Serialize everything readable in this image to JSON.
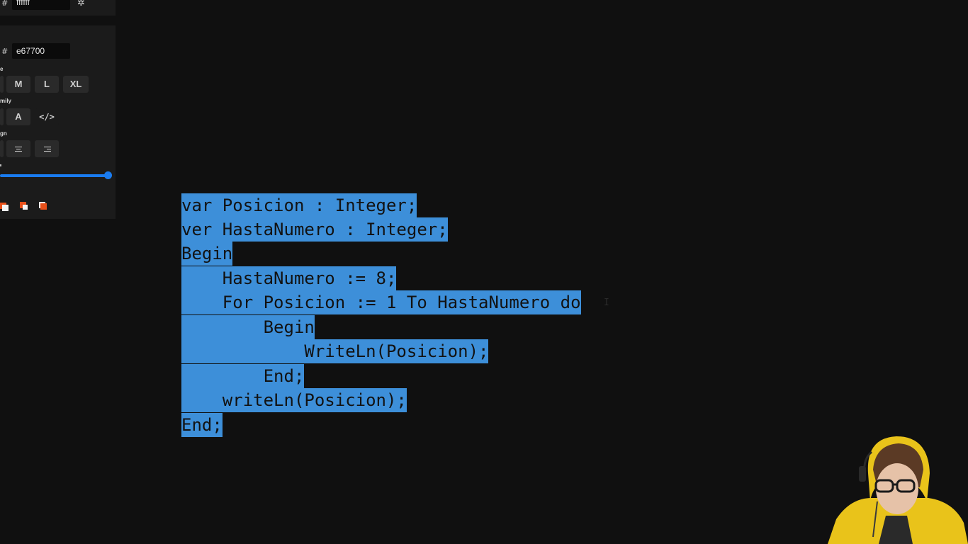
{
  "style_panel": {
    "stroke_hash": "#",
    "stroke_hex": "ffffff",
    "fill_hash": "#",
    "fill_hex": "e67700",
    "size_label": "e",
    "size_options": [
      "M",
      "L",
      "XL"
    ],
    "family_label": "mily",
    "family_options": [
      "A",
      "</>"
    ],
    "align_label": "gn",
    "opacity_percent": 100,
    "colors": {
      "panel_bg": "#1b1b1b",
      "accent": "#1a7cf0",
      "button_bg": "#2a2a2a",
      "layer_orange": "#e8501a"
    }
  },
  "code_block": {
    "selection_color": "#3d8fd9",
    "text_color": "#121212",
    "lines": [
      "var Posicion : Integer;",
      "ver HastaNumero : Integer;",
      "Begin",
      "    HastaNumero := 8;",
      "    For Posicion := 1 To HastaNumero do",
      "        Begin",
      "            WriteLn(Posicion);",
      "        End;",
      "    writeLn(Posicion);",
      "End;"
    ]
  },
  "webcam": {
    "hoodie_color": "#e9c31a",
    "shirt_color": "#2a2a2a"
  }
}
